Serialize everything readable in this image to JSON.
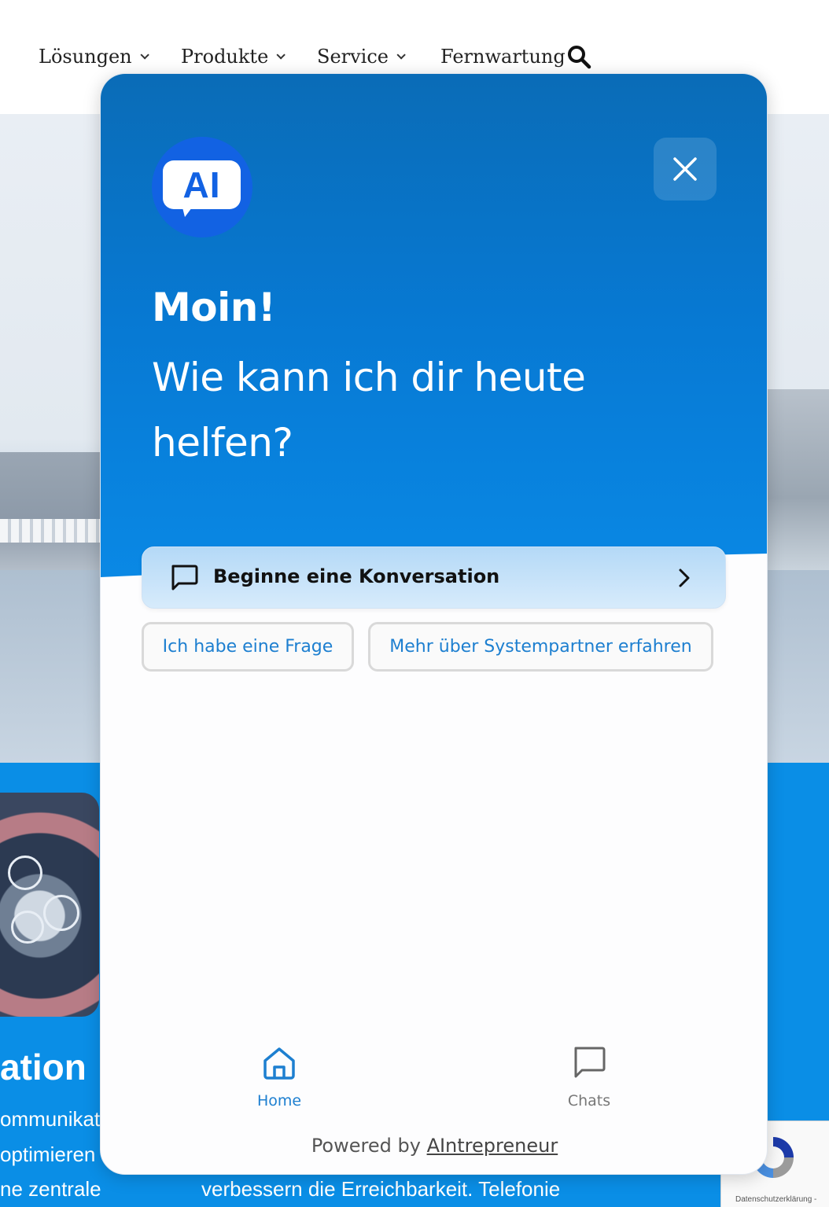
{
  "site_nav": {
    "items": [
      {
        "label": "Lösungen",
        "has_dropdown": true
      },
      {
        "label": "Produkte",
        "has_dropdown": true
      },
      {
        "label": "Service",
        "has_dropdown": true
      },
      {
        "label": "Fernwartung",
        "has_dropdown": false
      }
    ],
    "search_icon": "search-icon"
  },
  "background_section": {
    "heading_fragment": "ation",
    "lines": [
      "ommunikati",
      "optimieren S",
      "ne zentrale"
    ],
    "bottom_text": "verbessern die Erreichbarkeit. Telefonie",
    "band_color": "#0a8ee6"
  },
  "recaptcha": {
    "footer_text": "Datenschutzerklärung -"
  },
  "chat_widget": {
    "logo_text": "AI",
    "close_icon": "close-icon",
    "greeting": "Moin!",
    "subgreeting": "Wie kann ich dir heute helfen?",
    "start_conversation": {
      "label": "Beginne eine Konversation",
      "icon": "message-square-icon"
    },
    "quick_replies": [
      "Ich habe eine Frage",
      "Mehr über Systempartner erfahren"
    ],
    "tabs": [
      {
        "label": "Home",
        "icon": "home-icon",
        "active": true
      },
      {
        "label": "Chats",
        "icon": "chat-icon",
        "active": false
      }
    ],
    "powered_by_prefix": "Powered by",
    "powered_by_link": "AIntrepreneur",
    "colors": {
      "header": "#0779d3",
      "accent": "#1d7fd0",
      "logo": "#1262e3"
    }
  }
}
